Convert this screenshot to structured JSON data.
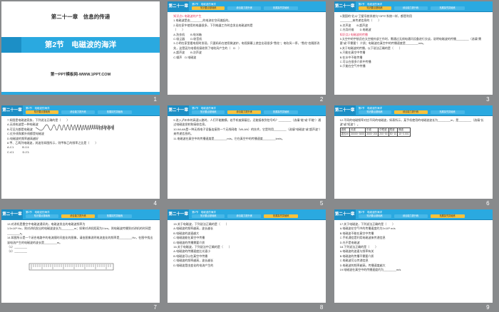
{
  "title_slide": {
    "chapter": "第二十一章　信息的传递",
    "section": "第2节　电磁波的海洋",
    "site": "第一PPT模板网-WWW.1PPT.COM"
  },
  "header": {
    "chapter": "第二十一章",
    "section": "第2节　电磁波的海洋",
    "tabs": [
      "知识要点基础练",
      "综合能力提升练",
      "拓展探究突破练"
    ]
  },
  "slides": [
    {
      "page": "1"
    },
    {
      "page": "2",
      "active_tab": 0,
      "lines": [
        {
          "t": "知识点1  电磁波的产生",
          "c": "hl"
        },
        {
          "t": "1.电磁波是由________的电流在空间激起的。"
        },
        {
          "t": "2.现在家中使用的电器很多，下列电器工作时会发出电磁波的是"
        },
        {
          "t": "（　　）"
        },
        {
          "t": "A.洗衣机　　B.电冰箱"
        },
        {
          "t": "C.吸尘器　　D.收音机"
        },
        {
          "t": "3.小明在家里看电视时发现，只要妈妈在使用微波炉，电视屏幕上就会出现很多\"雪花\"；电吹风一停，\"雪花\"也随即消失，这是因为电视机接收到了电吹风产生的（　D　）"
        },
        {
          "t": "A.超声波　　B.次声波"
        },
        {
          "t": "C.噪声　D.电磁波"
        }
      ]
    },
    {
      "page": "3",
      "active_tab": 0,
      "lines": [
        {
          "t": "4.我国的\"北斗\"卫星导航系统与\"GPS\"系统一样，都是利用"
        },
        {
          "t": "________来传递信息的（　　）"
        },
        {
          "t": "A.次声波　　B.超声波"
        },
        {
          "t": "C.光导纤维　　D.电磁波"
        },
        {
          "t": "知识点2  电磁波的传播",
          "c": "hl"
        },
        {
          "t": "5.太空中的宇航员在太空舱外部工作时，需通过无线电通讯设备进行交谈，说明电磁波的传播________（选填\"需要\"或\"不需要\"）介质；电磁波在真空中的传播速度是________m/s。"
        },
        {
          "t": "6.关于电磁波的传播，以下说法正确的是（　　）"
        },
        {
          "t": "A.只能在真空中传播"
        },
        {
          "t": "B.在水中不能传播"
        },
        {
          "t": "C.可以在很多介质中传播"
        },
        {
          "t": "D.只能在空气中传播"
        }
      ]
    },
    {
      "page": "4",
      "active_tab": 0,
      "lines": [
        {
          "t": "7.如图是电磁波家族，下列说法正确的是（　　）"
        },
        {
          "t": ""
        },
        {
          "t": "A.无线电波是一种电磁波"
        },
        {
          "t": "B.可见光都是电磁波"
        },
        {
          "t": "C.红外线和紫外线都是电磁波"
        },
        {
          "t": "D.电磁波的频率越高越好"
        },
        {
          "t": "8.甲、乙两列电磁波，其波形如图所示，则甲和乙的频率之比是（　　）"
        },
        {
          "t": "A.1∶1　　　B.1∶4"
        },
        {
          "t": "C.4∶1　　　D.2∶1"
        }
      ]
    },
    {
      "page": "5",
      "active_tab": 1,
      "lines": [
        {
          "t": ""
        },
        {
          "t": "9.进入泸州市的高速公路时，人们不能触摸，若手机被屏蔽后，还能接收到信号吗？________（选填\"能\"或\"不能\"）通过电磁波发射和接收信息。"
        },
        {
          "t": ""
        },
        {
          "t": "10.WLAN是一种无线电子设备连接到一个无线网络（WLAN）的技术，它是利用________（选填\"电磁波\"或\"超声波\"）来传递信息的。"
        },
        {
          "t": ""
        },
        {
          "t": "11.电磁波在真空中的传播速度是________m/s，它在真空中的传播速度________km/s。"
        }
      ]
    },
    {
      "page": "6",
      "active_tab": 1,
      "lines": [
        {
          "t": ""
        },
        {
          "t": "12.不同的电磁频率对应不同的电磁波，如表所示，某手机使用的电磁波波长为________m，是________（选填\"长波\"或\"短波\"）。"
        },
        {
          "t": ""
        },
        {
          "t": ""
        }
      ],
      "table": [
        [
          "波段",
          "长波",
          "中波",
          "中短波",
          "短波",
          "微波"
        ],
        [
          "波长/m",
          "30000~3000",
          "3000~200",
          "200~50",
          "50~10",
          "10~0.001"
        ]
      ]
    },
    {
      "page": "7",
      "active_tab": 1,
      "lines": [
        {
          "t": "13.对讲机是靠空中电磁波通讯的，电磁波发出的电磁波频率为"
        },
        {
          "t": "1.5×10⁸ Hz，则对讲机发出的电磁波波长为________m；如果对讲机距离为3 km，则电磁波传播到对讲机的时间是________s。"
        },
        {
          "t": ""
        },
        {
          "t": "14.如图所示是一个闭合电路中的电流随时间变化的图像，请由图像说明电流变化的频率是________Hz，在图中找出该电流产生的电磁波的波长是________m。"
        },
        {
          "t": ""
        },
        {
          "t": "（1）________"
        },
        {
          "t": "（2）________"
        }
      ]
    },
    {
      "page": "8",
      "active_tab": 2,
      "lines": [
        {
          "t": "15.关于电磁波，下列说法正确的是（　　）"
        },
        {
          "t": "A.电磁波的频率越高，波长越长"
        },
        {
          "t": "B.电磁波的波速越大"
        },
        {
          "t": "C.电磁波能在真空中传播"
        },
        {
          "t": "D.电磁波的传播需要介质"
        },
        {
          "t": "16.关于电磁波，下列说法中正确的是（　　）"
        },
        {
          "t": "A.电磁波的传播速度比光速小"
        },
        {
          "t": "B.电磁波可以在真空中传播"
        },
        {
          "t": "C.电磁波的频率越高，波长越长"
        },
        {
          "t": "D.电磁波是由变化的电流产生的"
        }
      ]
    },
    {
      "page": "9",
      "active_tab": 2,
      "lines": [
        {
          "t": "17.关于电磁波，下列说法正确的是（　　）"
        },
        {
          "t": "A.电磁波在空气中的传播速度约为3×10⁸ m/s"
        },
        {
          "t": "B.电磁波不能在真空中传播"
        },
        {
          "t": "C.手机通信是利用电磁波来传递信息"
        },
        {
          "t": "D.光不是电磁波"
        },
        {
          "t": "18.下列说法正确的是（　　）"
        },
        {
          "t": "A.电磁波的波速与频率有关"
        },
        {
          "t": "B.电磁波的传播不需要介质"
        },
        {
          "t": "C.电磁波可以传递信息"
        },
        {
          "t": "D.电磁波的频率越高，传播速度越大"
        },
        {
          "t": "19.电磁波在真空中的传播速度约为________m/s"
        }
      ]
    }
  ]
}
